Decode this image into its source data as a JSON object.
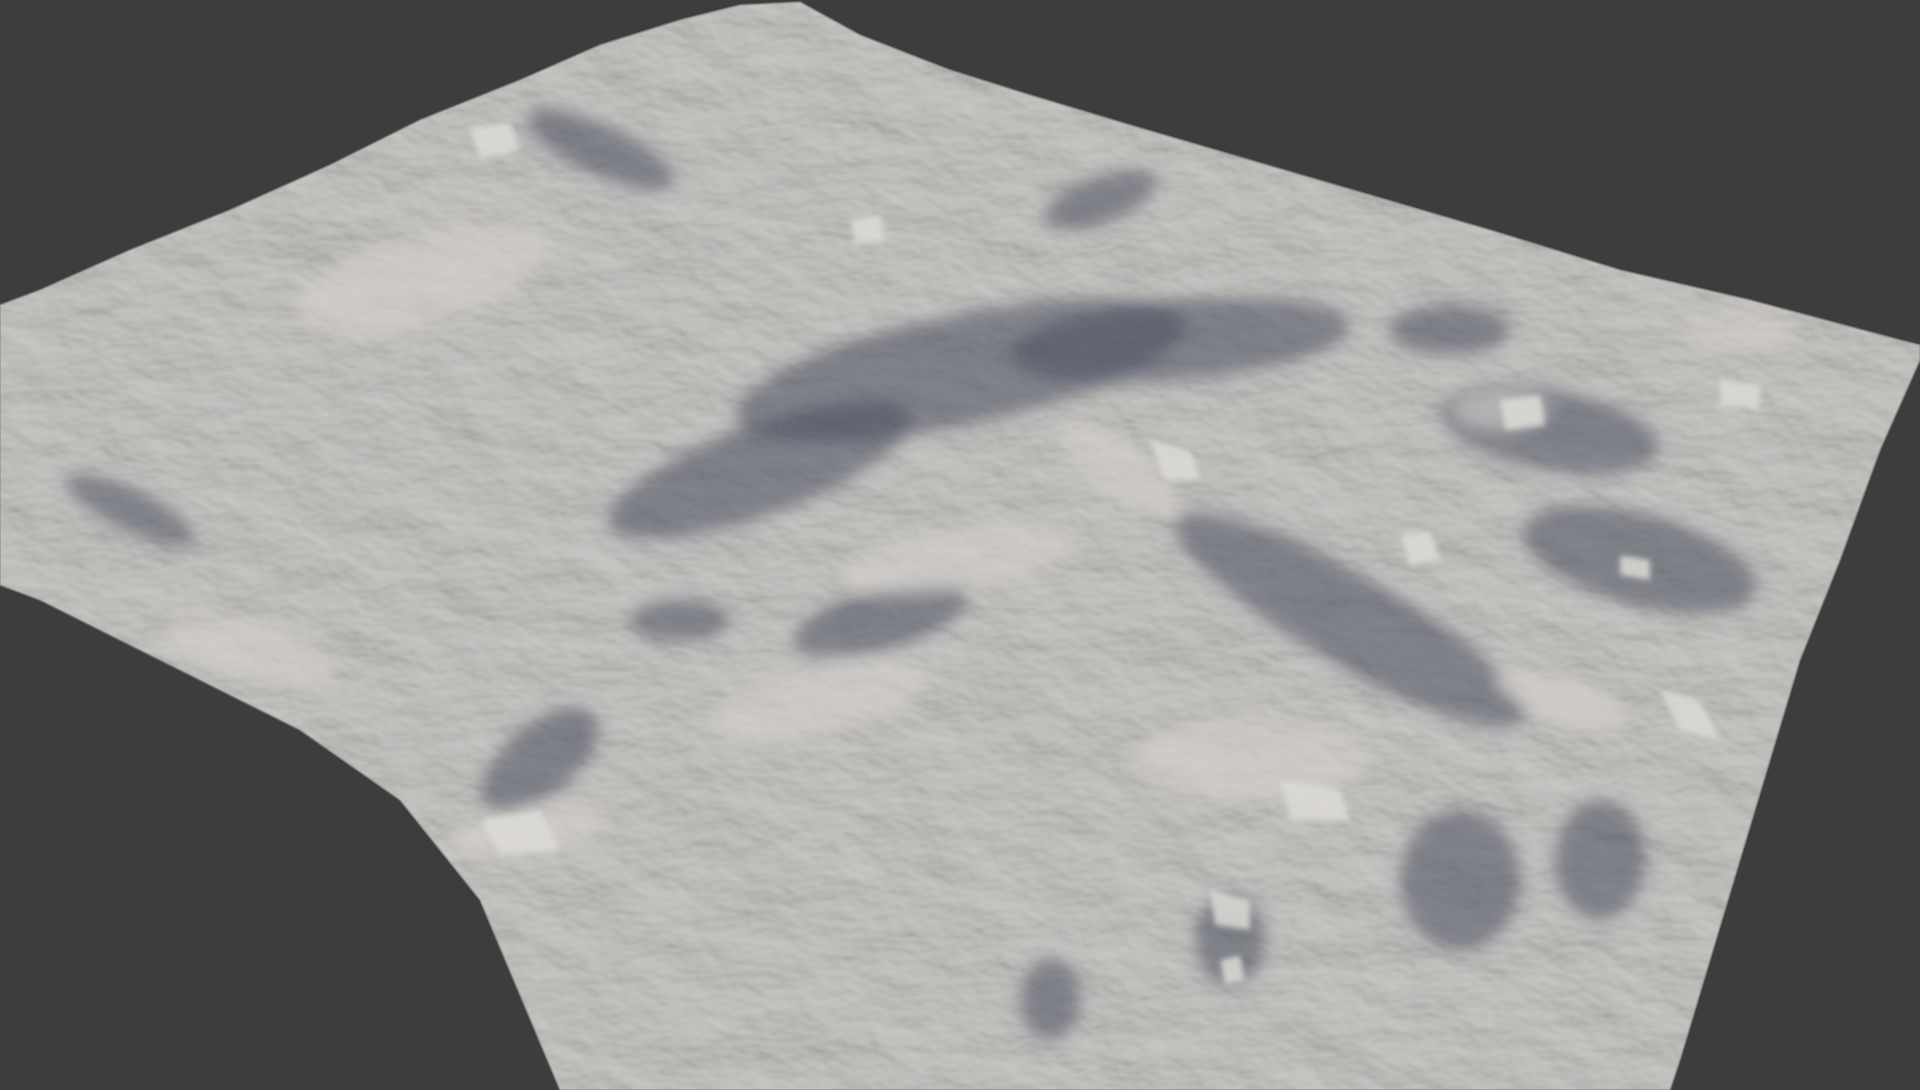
{
  "viewport": {
    "background_color": "#3d3d3d"
  },
  "terrain": {
    "surface_color": "#b4b1ad",
    "highlight_color": "#d8d5d0",
    "shadow_color": "#4a4a55",
    "shadow_tint": "#3c4054",
    "rock_color": "#e2dfda"
  }
}
